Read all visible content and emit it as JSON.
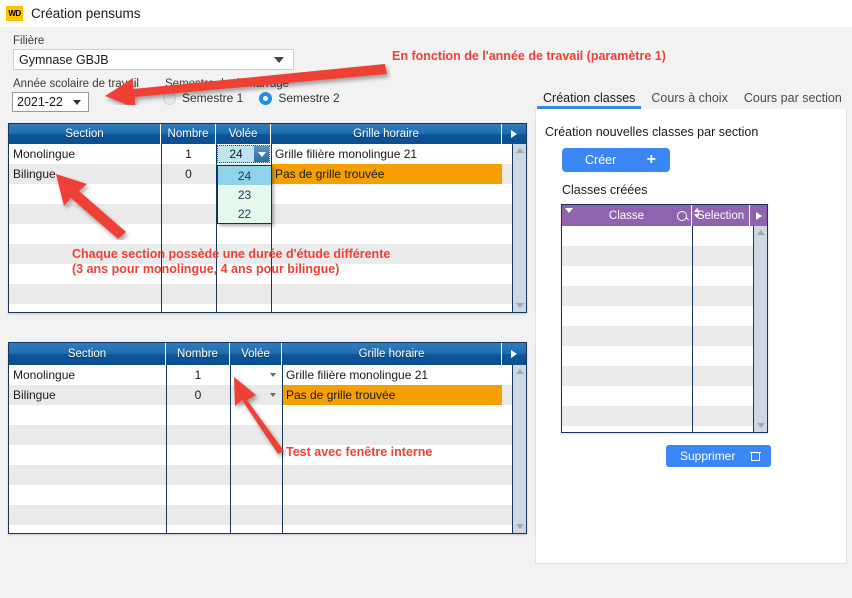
{
  "window": {
    "title": "Création pensums",
    "logo_text": "WD"
  },
  "form": {
    "filiere_label": "Filière",
    "filiere_value": "Gymnase GBJB",
    "annee_label": "Année scolaire de travail",
    "annee_value": "2021-22",
    "semestre_label": "Semestre de démarrage",
    "semestre_options": [
      {
        "label": "Semestre 1",
        "selected": false
      },
      {
        "label": "Semestre 2",
        "selected": true
      }
    ]
  },
  "table_top": {
    "columns": [
      "Section",
      "Nombre",
      "Volée",
      "Grille horaire"
    ],
    "rows": [
      {
        "section": "Monolingue",
        "nombre": "1",
        "volee": "24",
        "grille": "Grille filière monolingue 21",
        "grille_highlight": false
      },
      {
        "section": "Bilingue",
        "nombre": "0",
        "volee": "",
        "grille": "Pas de grille trouvée",
        "grille_highlight": true
      }
    ],
    "combo_open": true,
    "combo_options": [
      "24",
      "23",
      "22"
    ],
    "combo_selected": "24"
  },
  "table_bottom": {
    "columns": [
      "Section",
      "Nombre",
      "Volée",
      "Grille horaire"
    ],
    "rows": [
      {
        "section": "Monolingue",
        "nombre": "1",
        "volee": "",
        "grille": "Grille filière monolingue 21",
        "grille_highlight": false
      },
      {
        "section": "Bilingue",
        "nombre": "0",
        "volee": "",
        "grille": "Pas de grille trouvée",
        "grille_highlight": true
      }
    ]
  },
  "tabs": [
    {
      "label": "Création classes",
      "active": true
    },
    {
      "label": "Cours à choix",
      "active": false
    },
    {
      "label": "Cours par section",
      "active": false
    }
  ],
  "panel": {
    "title": "Création nouvelles classes par section",
    "creer_label": "Créer",
    "creer_plus": "+",
    "classes_creees_label": "Classes créées",
    "supprimer_label": "Supprimer",
    "classes_table": {
      "columns": [
        "Classe",
        "Selection"
      ],
      "rows": []
    }
  },
  "annotations": [
    {
      "id": "a1",
      "text": "En fonction de l'année de travail (paramètre 1)"
    },
    {
      "id": "a2",
      "text": "Chaque section possède une durée d'étude différente\n(3 ans pour monolingue, 4 ans pour bilingue)"
    },
    {
      "id": "a3",
      "text": "Test avec fenêtre interne"
    }
  ],
  "colors": {
    "accent_blue": "#3a86f7",
    "table_header_blue": "#0d559a",
    "table_header_purple": "#8f63ad",
    "highlight_orange": "#f5a000",
    "annotation_red": "#ef4136",
    "logo_yellow": "#ffc400"
  }
}
